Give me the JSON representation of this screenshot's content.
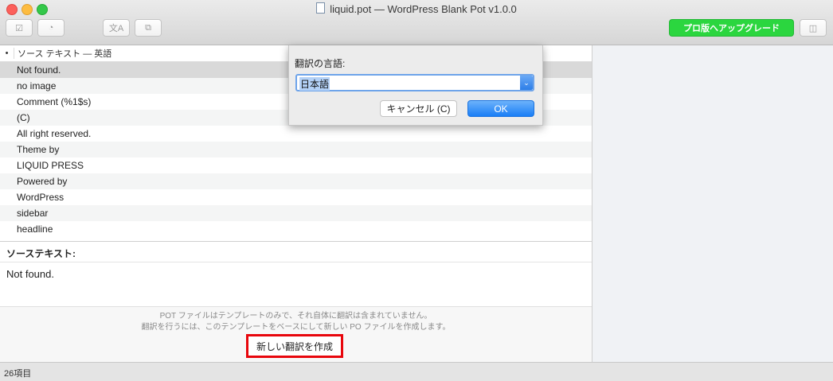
{
  "window": {
    "title": "liquid.pot — WordPress Blank Pot v1.0.0"
  },
  "toolbar": {
    "icons": [
      "checkbox-icon",
      "stats-icon",
      "translate-icon",
      "puzzle-icon",
      "sidebar-toggle-icon"
    ],
    "upgrade_label": "プロ版へアップグレード",
    "accent": "#2bd63f"
  },
  "list": {
    "header_bullet": "•",
    "header_label": "ソース テキスト — 英語",
    "items": [
      "Not found.",
      "no image",
      "Comment (%1$s)",
      "(C)",
      "All right reserved.",
      "Theme by",
      "LIQUID PRESS",
      "Powered by",
      "WordPress",
      "sidebar",
      "headline"
    ]
  },
  "source": {
    "label": "ソーステキスト:",
    "text": "Not found."
  },
  "info": {
    "line1": "POT ファイルはテンプレートのみで、それ自体に翻訳は含まれていません。",
    "line2": "翻訳を行うには、このテンプレートをベースにして新しい PO ファイルを作成します。",
    "create_label": "新しい翻訳を作成",
    "highlight_color": "#e8060c"
  },
  "status": {
    "count": "26項目"
  },
  "dialog": {
    "label": "翻訳の言語:",
    "selected": "日本語",
    "cancel_label": "キャンセル (C)",
    "ok_label": "OK"
  }
}
